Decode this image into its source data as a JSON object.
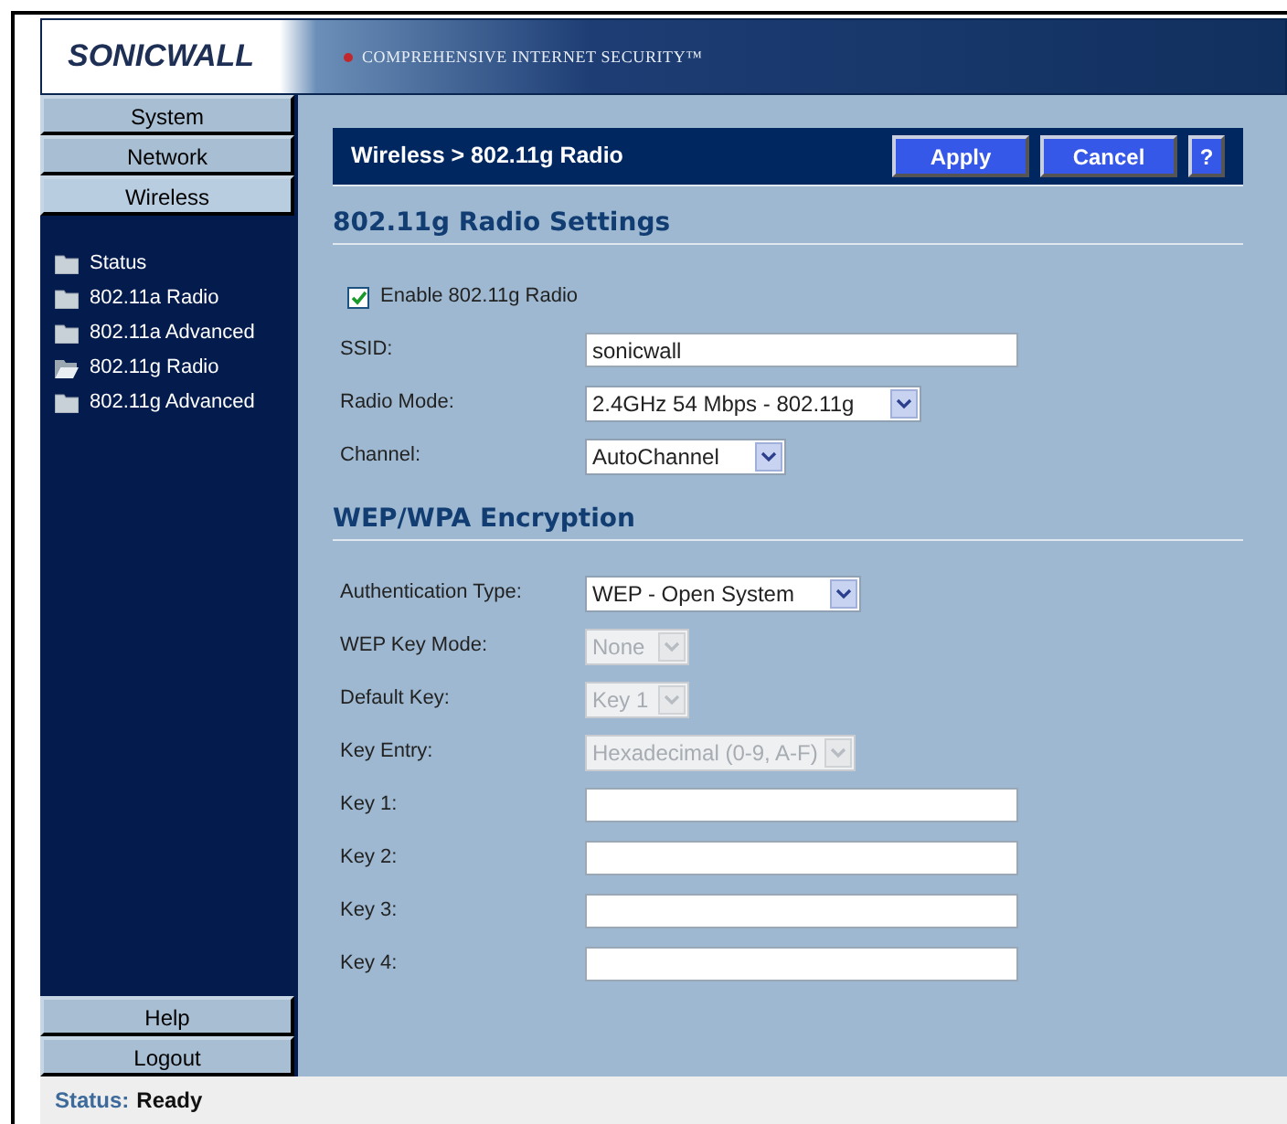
{
  "header": {
    "logo": "SONICWALL",
    "tagline": "COMPREHENSIVE INTERNET SECURITY™"
  },
  "sidebar": {
    "menu": [
      {
        "label": "System",
        "selected": false
      },
      {
        "label": "Network",
        "selected": false
      },
      {
        "label": "Wireless",
        "selected": true
      }
    ],
    "items": [
      {
        "label": "Status",
        "selected": false
      },
      {
        "label": "802.11a Radio",
        "selected": false
      },
      {
        "label": "802.11a Advanced",
        "selected": false
      },
      {
        "label": "802.11g Radio",
        "selected": true
      },
      {
        "label": "802.11g Advanced",
        "selected": false
      }
    ],
    "bottom_buttons": [
      "Help",
      "Logout"
    ]
  },
  "page_title": "Wireless > 802.11g Radio",
  "buttons": [
    {
      "label": "Apply",
      "kind": "text"
    },
    {
      "label": "Cancel",
      "kind": "text"
    },
    {
      "label": "?",
      "kind": "help"
    }
  ],
  "sections": [
    {
      "title": "802.11g Radio Settings",
      "fields": [
        {
          "kind": "checkbox",
          "label": "Enable 802.11g Radio",
          "checked": true
        },
        {
          "kind": "text",
          "label": "SSID:",
          "value": "sonicwall"
        },
        {
          "kind": "select",
          "label": "Radio Mode:",
          "value": "2.4GHz 54 Mbps - 802.11g",
          "disabled": false
        },
        {
          "kind": "select",
          "label": "Channel:",
          "value": "AutoChannel",
          "disabled": false
        }
      ]
    },
    {
      "title": "WEP/WPA Encryption",
      "fields": [
        {
          "kind": "select",
          "label": "Authentication Type:",
          "value": "WEP - Open System",
          "disabled": false
        },
        {
          "kind": "select",
          "label": "WEP Key Mode:",
          "value": "None",
          "disabled": true
        },
        {
          "kind": "select",
          "label": "Default Key:",
          "value": "Key 1",
          "disabled": true
        },
        {
          "kind": "select",
          "label": "Key Entry:",
          "value": "Hexadecimal (0-9, A-F)",
          "disabled": true
        },
        {
          "kind": "text",
          "label": "Key 1:"
        },
        {
          "kind": "text",
          "label": "Key 2:"
        },
        {
          "kind": "text",
          "label": "Key 3:"
        },
        {
          "kind": "text",
          "label": "Key 4:"
        }
      ]
    }
  ],
  "status_bar": {
    "label": "Status:",
    "value": "Ready"
  }
}
